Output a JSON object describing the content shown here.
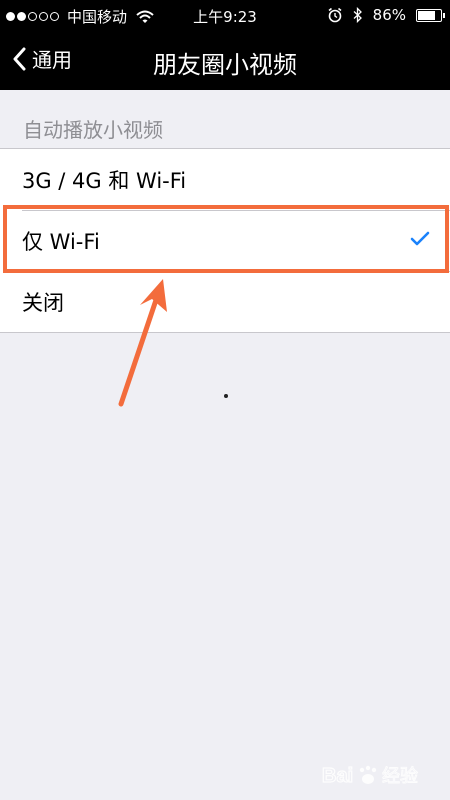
{
  "status_bar": {
    "carrier": "中国移动",
    "time": "上午9:23",
    "battery": "86%",
    "battery_level": 0.86,
    "signal_bars": 2,
    "icons": [
      "signal-dots-icon",
      "wifi-icon",
      "alarm-icon",
      "bluetooth-icon",
      "battery-icon"
    ]
  },
  "nav": {
    "back_label": "通用",
    "title": "朋友圈小视频"
  },
  "settings": {
    "section_header": "自动播放小视频",
    "options": [
      {
        "label": "3G / 4G 和 Wi-Fi",
        "selected": false
      },
      {
        "label": "仅 Wi-Fi",
        "selected": true
      },
      {
        "label": "关闭",
        "selected": false
      }
    ]
  },
  "colors": {
    "accent": "#1a82fb",
    "annotation": "#f36c3c",
    "background": "#efeff4",
    "bar": "#000000"
  },
  "watermark": {
    "text": "Bai du 经验"
  }
}
